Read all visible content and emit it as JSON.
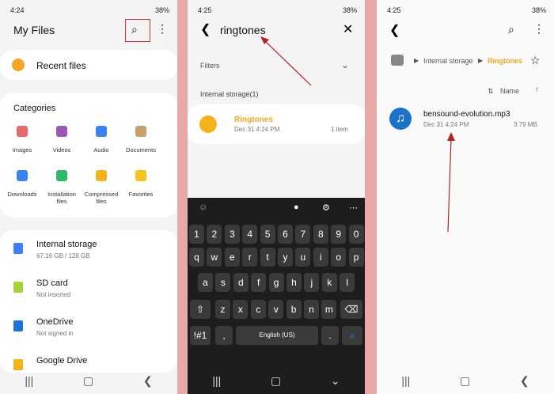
{
  "p1": {
    "status": {
      "time": "4:24",
      "battery": "38%"
    },
    "title": "My Files",
    "recent": "Recent files",
    "categories_title": "Categories",
    "categories": [
      "Images",
      "Videos",
      "Audio",
      "Documents",
      "Downloads",
      "Installation files",
      "Compressed files",
      "Favorites"
    ],
    "storage": [
      {
        "name": "Internal storage",
        "sub": "67.16 GB / 128 GB"
      },
      {
        "name": "SD card",
        "sub": "Not inserted"
      },
      {
        "name": "OneDrive",
        "sub": "Not signed in"
      },
      {
        "name": "Google Drive",
        "sub": ""
      }
    ]
  },
  "p2": {
    "status": {
      "time": "4:25",
      "battery": "38%"
    },
    "query": "ringtones",
    "filters": "Filters",
    "section": "Internal storage(1)",
    "result": {
      "name": "Ringtones",
      "date": "Dec 31 4:24 PM",
      "count": "1 item"
    },
    "keyboard": {
      "row1": [
        "1",
        "2",
        "3",
        "4",
        "5",
        "6",
        "7",
        "8",
        "9",
        "0"
      ],
      "row2": [
        "q",
        "w",
        "e",
        "r",
        "t",
        "y",
        "u",
        "i",
        "o",
        "p"
      ],
      "row3": [
        "a",
        "s",
        "d",
        "f",
        "g",
        "h",
        "j",
        "k",
        "l"
      ],
      "row4": [
        "z",
        "x",
        "c",
        "v",
        "b",
        "n",
        "m"
      ],
      "sym": "!#1",
      "comma": ",",
      "space": "English (US)",
      "period": "."
    }
  },
  "p3": {
    "status": {
      "time": "4:25",
      "battery": "38%"
    },
    "breadcrumb": {
      "root": "Internal storage",
      "current": "Ringtones"
    },
    "sort": "Name",
    "file": {
      "name": "bensound-evolution.mp3",
      "date": "Dec 31 4:24 PM",
      "size": "3.79 MB"
    }
  },
  "colors": {
    "accent": "#f5a623",
    "arrow": "#b22222",
    "folder": "#f6b21b"
  }
}
